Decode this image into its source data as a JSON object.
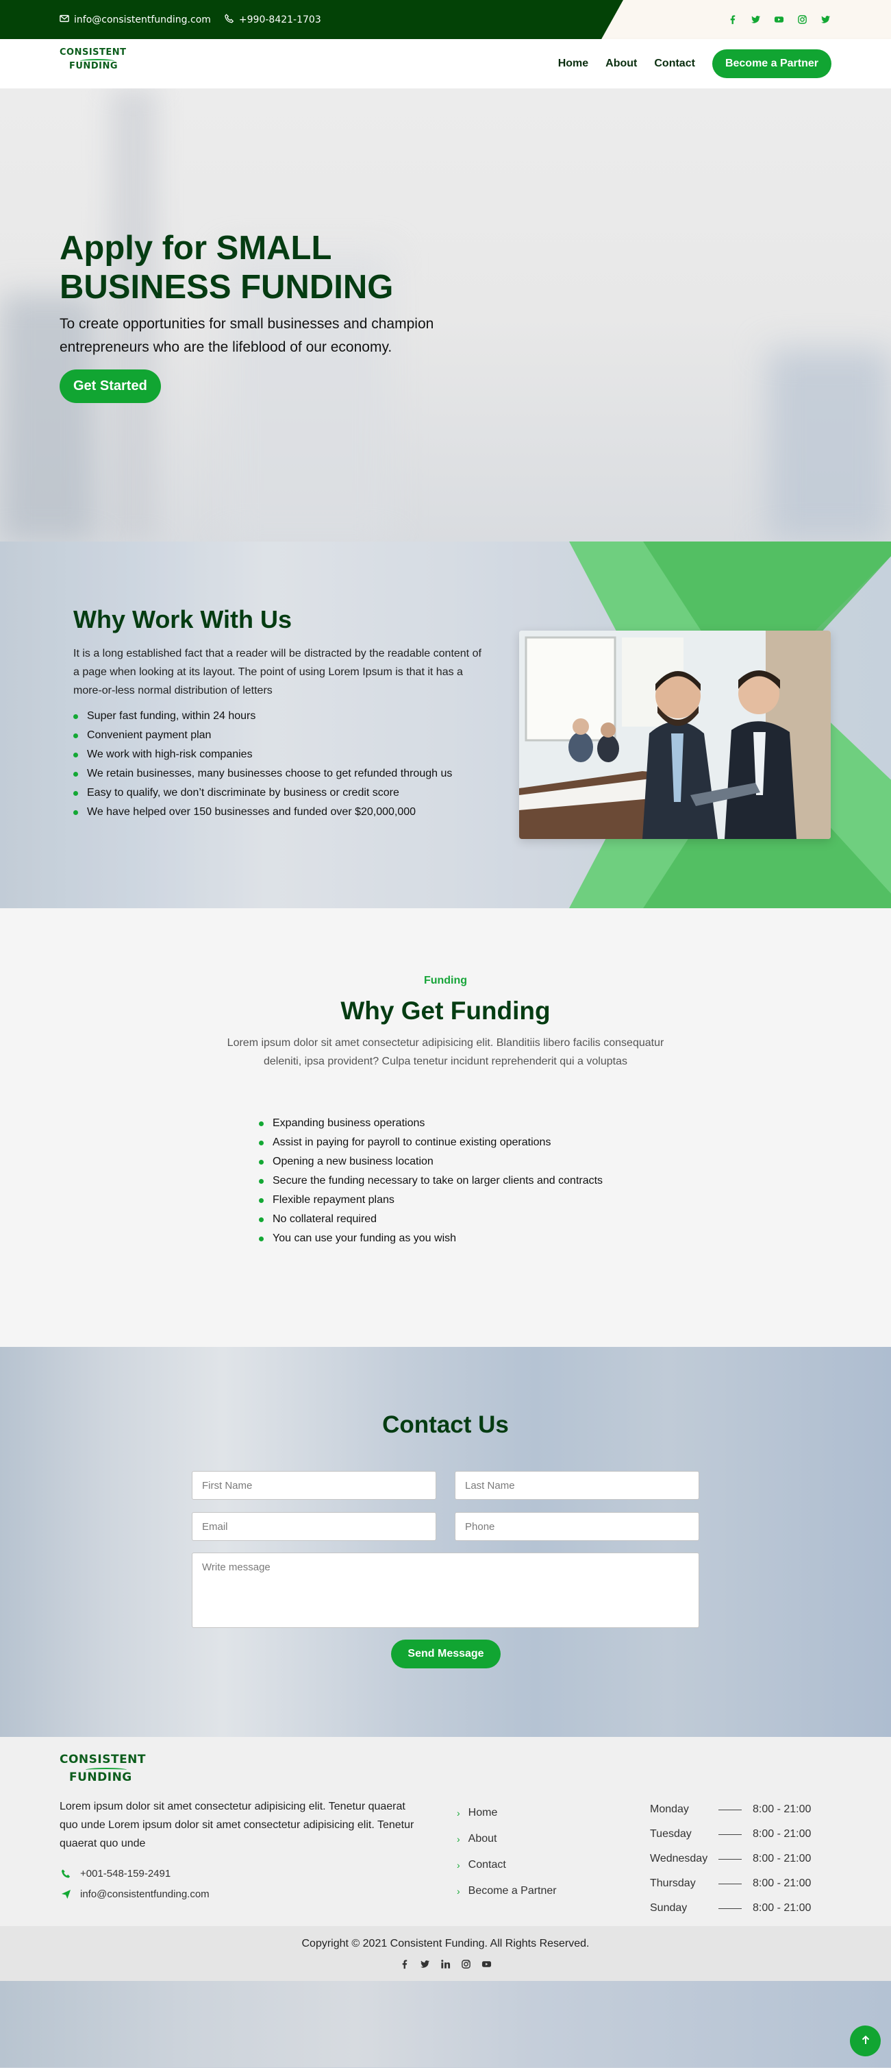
{
  "topbar": {
    "email": "info@consistentfunding.com",
    "phone": "+990-8421-1703",
    "social": [
      "facebook-icon",
      "twitter-icon",
      "youtube-icon",
      "instagram-icon",
      "twitter-icon"
    ]
  },
  "brand": {
    "line1": "CONSISTENT",
    "line2": "FUNDING"
  },
  "nav": {
    "items": [
      "Home",
      "About",
      "Contact"
    ],
    "cta": "Become a Partner"
  },
  "hero": {
    "title_light": "Apply for",
    "title_bold_1": "SMALL",
    "title_bold_2": "BUSINESS FUNDING",
    "subtitle": "To create opportunities for small businesses and champion entrepreneurs who are the lifeblood of our economy.",
    "cta": "Get Started"
  },
  "why_work": {
    "title": "Why Work With Us",
    "description": "It is a long established fact that a reader will be distracted by the readable content of a page when looking at its layout. The point of using Lorem Ipsum is that it has a more-or-less normal distribution of letters",
    "items": [
      "Super fast funding, within 24 hours",
      "Convenient payment plan",
      "We work with high-risk companies",
      "We retain businesses, many businesses choose to get refunded through us",
      "Easy to qualify, we don’t discriminate by business or credit score",
      "We have helped over 150 businesses and funded over $20,000,000"
    ]
  },
  "funding": {
    "kicker": "Funding",
    "title": "Why Get Funding",
    "description": "Lorem ipsum dolor sit amet consectetur adipisicing elit. Blanditiis libero facilis consequatur deleniti, ipsa provident? Culpa tenetur incidunt reprehenderit qui a voluptas",
    "items": [
      "Expanding business operations",
      "Assist in paying for payroll to continue existing operations",
      "Opening a new business location",
      "Secure the funding necessary to take on larger clients and contracts",
      "Flexible repayment plans",
      "No collateral required",
      "You can use your funding as you wish"
    ]
  },
  "contact": {
    "title": "Contact Us",
    "first_name_placeholder": "First Name",
    "last_name_placeholder": "Last Name",
    "email_placeholder": "Email",
    "phone_placeholder": "Phone",
    "message_placeholder": "Write message",
    "submit": "Send Message"
  },
  "footer": {
    "description": "Lorem ipsum dolor sit amet consectetur adipisicing elit. Tenetur quaerat quo unde Lorem ipsum dolor sit amet consectetur adipisicing elit. Tenetur quaerat quo unde",
    "phone": "+001-548-159-2491",
    "email": "info@consistentfunding.com",
    "links": [
      "Home",
      "About",
      "Contact",
      "Become a Partner"
    ],
    "hours": [
      {
        "day": "Monday",
        "time": "8:00 - 21:00"
      },
      {
        "day": "Tuesday",
        "time": "8:00 - 21:00"
      },
      {
        "day": "Wednesday",
        "time": "8:00 - 21:00"
      },
      {
        "day": "Thursday",
        "time": "8:00 - 21:00"
      },
      {
        "day": "Sunday",
        "time": "8:00 - 21:00"
      }
    ],
    "copyright": "Copyright © 2021 Consistent Funding. All Rights Reserved.",
    "social": [
      "facebook-icon",
      "twitter-icon",
      "linkedin-icon",
      "instagram-icon",
      "youtube-icon"
    ]
  },
  "colors": {
    "accent": "#11a532",
    "dark_green": "#053c12",
    "topbar": "#034206"
  }
}
